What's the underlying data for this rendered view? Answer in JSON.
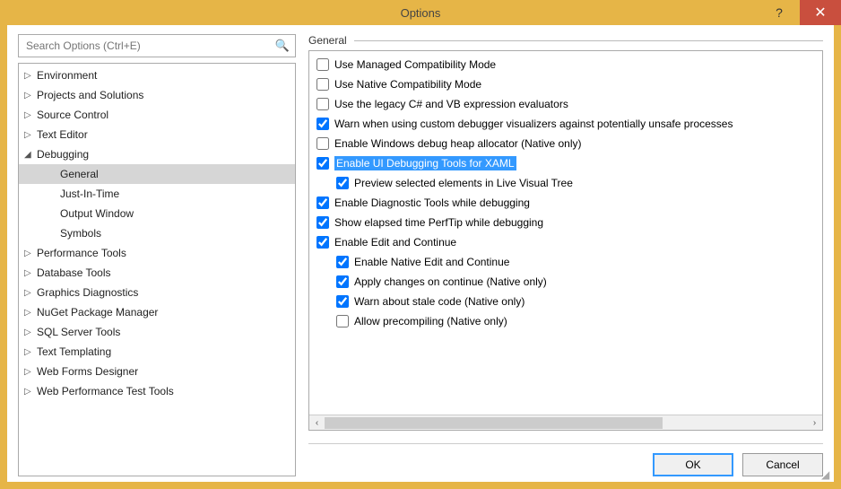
{
  "window": {
    "title": "Options",
    "help_glyph": "?",
    "close_glyph": "✕"
  },
  "search": {
    "placeholder": "Search Options (Ctrl+E)"
  },
  "tree": {
    "items": [
      {
        "label": "Environment",
        "expanded": false,
        "selected": false,
        "children": []
      },
      {
        "label": "Projects and Solutions",
        "expanded": false,
        "selected": false,
        "children": []
      },
      {
        "label": "Source Control",
        "expanded": false,
        "selected": false,
        "children": []
      },
      {
        "label": "Text Editor",
        "expanded": false,
        "selected": false,
        "children": []
      },
      {
        "label": "Debugging",
        "expanded": true,
        "selected": false,
        "children": [
          {
            "label": "General",
            "selected": true
          },
          {
            "label": "Just-In-Time",
            "selected": false
          },
          {
            "label": "Output Window",
            "selected": false
          },
          {
            "label": "Symbols",
            "selected": false
          }
        ]
      },
      {
        "label": "Performance Tools",
        "expanded": false,
        "selected": false,
        "children": []
      },
      {
        "label": "Database Tools",
        "expanded": false,
        "selected": false,
        "children": []
      },
      {
        "label": "Graphics Diagnostics",
        "expanded": false,
        "selected": false,
        "children": []
      },
      {
        "label": "NuGet Package Manager",
        "expanded": false,
        "selected": false,
        "children": []
      },
      {
        "label": "SQL Server Tools",
        "expanded": false,
        "selected": false,
        "children": []
      },
      {
        "label": "Text Templating",
        "expanded": false,
        "selected": false,
        "children": []
      },
      {
        "label": "Web Forms Designer",
        "expanded": false,
        "selected": false,
        "children": []
      },
      {
        "label": "Web Performance Test Tools",
        "expanded": false,
        "selected": false,
        "children": []
      }
    ]
  },
  "panel": {
    "title": "General",
    "options": [
      {
        "label": "Use Managed Compatibility Mode",
        "checked": false,
        "indent": 0,
        "highlight": false
      },
      {
        "label": "Use Native Compatibility Mode",
        "checked": false,
        "indent": 0,
        "highlight": false
      },
      {
        "label": "Use the legacy C# and VB expression evaluators",
        "checked": false,
        "indent": 0,
        "highlight": false
      },
      {
        "label": "Warn when using custom debugger visualizers against potentially unsafe processes",
        "checked": true,
        "indent": 0,
        "highlight": false
      },
      {
        "label": "Enable Windows debug heap allocator (Native only)",
        "checked": false,
        "indent": 0,
        "highlight": false
      },
      {
        "label": "Enable UI Debugging Tools for XAML",
        "checked": true,
        "indent": 0,
        "highlight": true
      },
      {
        "label": "Preview selected elements in Live Visual Tree",
        "checked": true,
        "indent": 1,
        "highlight": false
      },
      {
        "label": "Enable Diagnostic Tools while debugging",
        "checked": true,
        "indent": 0,
        "highlight": false
      },
      {
        "label": "Show elapsed time PerfTip while debugging",
        "checked": true,
        "indent": 0,
        "highlight": false
      },
      {
        "label": "Enable Edit and Continue",
        "checked": true,
        "indent": 0,
        "highlight": false
      },
      {
        "label": "Enable Native Edit and Continue",
        "checked": true,
        "indent": 1,
        "highlight": false
      },
      {
        "label": "Apply changes on continue (Native only)",
        "checked": true,
        "indent": 1,
        "highlight": false
      },
      {
        "label": "Warn about stale code (Native only)",
        "checked": true,
        "indent": 1,
        "highlight": false
      },
      {
        "label": "Allow precompiling (Native only)",
        "checked": false,
        "indent": 1,
        "highlight": false
      }
    ]
  },
  "buttons": {
    "ok": "OK",
    "cancel": "Cancel"
  },
  "glyphs": {
    "caret_collapsed": "▷",
    "caret_expanded": "◢",
    "search": "🔍"
  }
}
